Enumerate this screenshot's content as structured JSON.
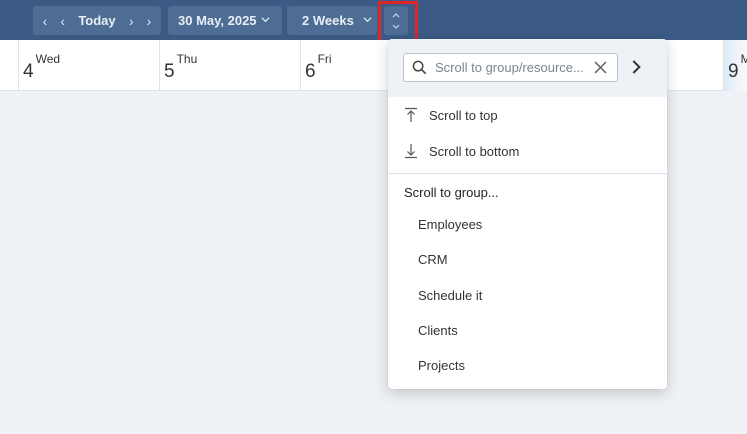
{
  "toolbar": {
    "today_label": "Today",
    "date_label": "30 May, 2025",
    "range_label": "2 Weeks",
    "icons": {
      "prev_prev": "chevron-left-icon",
      "prev": "chevron-left-icon",
      "next": "chevron-right-icon",
      "next_next": "chevron-right-icon",
      "dropdown": "chevron-down-icon",
      "scroll": "up-down-chevron-icon"
    },
    "colors": {
      "bar": "#3b5b85",
      "button": "#4e6d95",
      "highlight": "#e0262b"
    }
  },
  "days": [
    {
      "num": "4",
      "dow": "Wed"
    },
    {
      "num": "5",
      "dow": "Thu"
    },
    {
      "num": "6",
      "dow": "Fri"
    },
    {
      "num": "9",
      "dow": "M"
    }
  ],
  "popup": {
    "search": {
      "placeholder": "Scroll to group/resource...",
      "value": ""
    },
    "actions": [
      {
        "label": "Scroll to top",
        "icon": "arrow-to-top-icon"
      },
      {
        "label": "Scroll to bottom",
        "icon": "arrow-to-bottom-icon"
      }
    ],
    "section_title": "Scroll to group...",
    "groups": [
      "Employees",
      "CRM",
      "Schedule it",
      "Clients",
      "Projects"
    ]
  }
}
